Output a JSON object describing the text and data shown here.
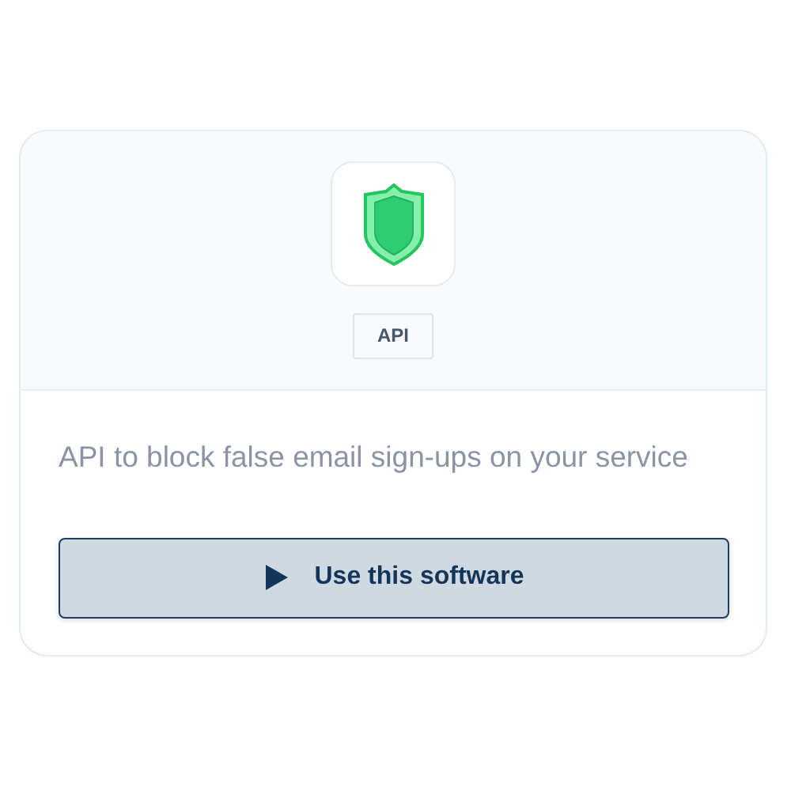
{
  "card": {
    "tag": "API",
    "description": "API to block false email sign-ups on your service",
    "button": {
      "label": "Use this software"
    }
  }
}
